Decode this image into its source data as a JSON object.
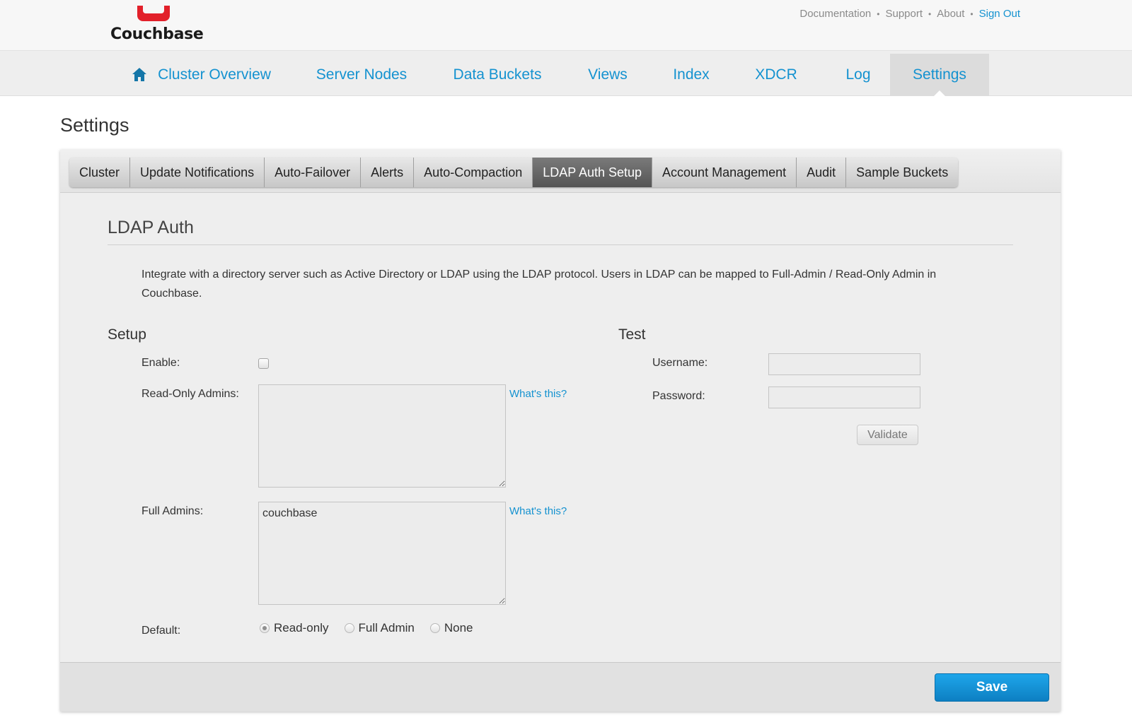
{
  "brand": {
    "name": "Couchbase",
    "accent_color": "#e2202a",
    "link_color": "#1492d0"
  },
  "toplinks": {
    "documentation": "Documentation",
    "support": "Support",
    "about": "About",
    "signout": "Sign Out",
    "separator": "•"
  },
  "nav": {
    "home_icon": "home-icon",
    "items": [
      "Cluster Overview",
      "Server Nodes",
      "Data Buckets",
      "Views",
      "Index",
      "XDCR",
      "Log",
      "Settings"
    ],
    "active": "Settings"
  },
  "page_title": "Settings",
  "tabs": {
    "items": [
      "Cluster",
      "Update Notifications",
      "Auto-Failover",
      "Alerts",
      "Auto-Compaction",
      "LDAP Auth Setup",
      "Account Management",
      "Audit",
      "Sample Buckets"
    ],
    "active": "LDAP Auth Setup"
  },
  "ldap": {
    "title": "LDAP Auth",
    "intro": "Integrate with a directory server such as Active Directory or LDAP using the LDAP protocol. Users in LDAP can be mapped to Full-Admin / Read-Only Admin in Couchbase.",
    "setup": {
      "title": "Setup",
      "enable_label": "Enable:",
      "enable_checked": false,
      "readonly_label": "Read-Only Admins:",
      "readonly_value": "",
      "full_label": "Full Admins:",
      "full_value": "couchbase",
      "whats_this": "What's this?",
      "default_label": "Default:",
      "default_options": [
        "Read-only",
        "Full Admin",
        "None"
      ],
      "default_selected": "Read-only"
    },
    "test": {
      "title": "Test",
      "username_label": "Username:",
      "username_value": "",
      "password_label": "Password:",
      "password_value": "",
      "validate_label": "Validate"
    },
    "save_label": "Save"
  }
}
